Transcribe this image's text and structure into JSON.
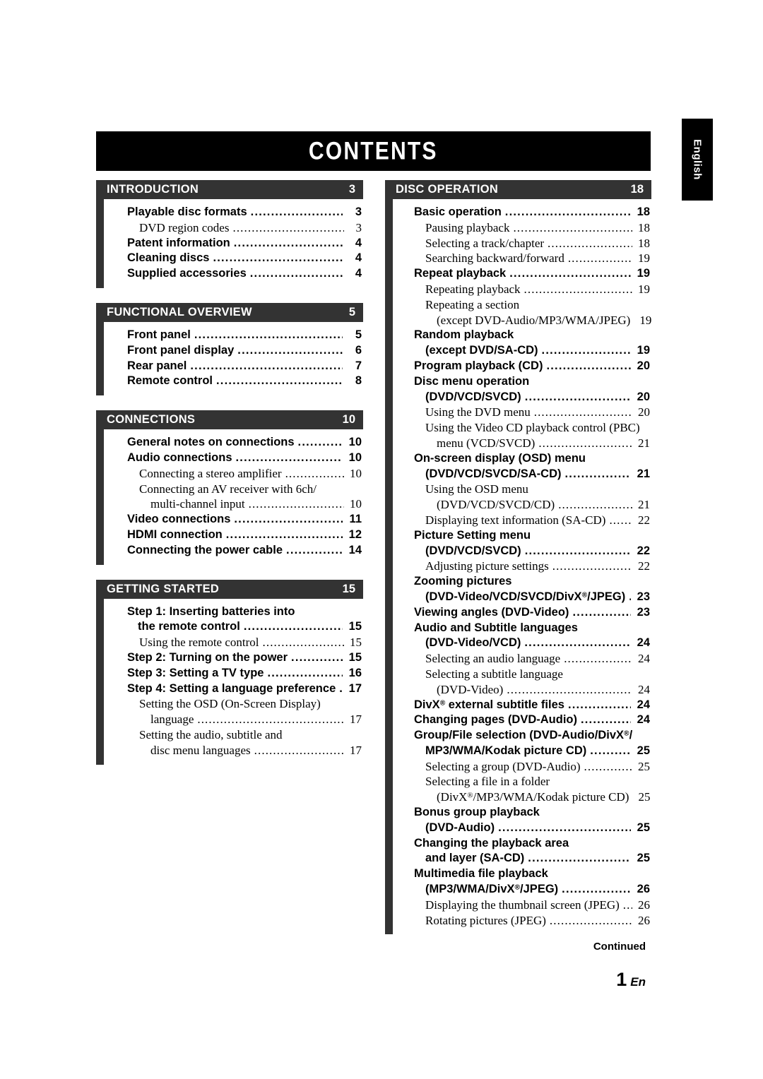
{
  "document": {
    "title": "CONTENTS",
    "language_tab": "English",
    "continued_label": "Continued",
    "page_number": "1",
    "page_suffix": "En",
    "colors": {
      "title_bar": "#000000",
      "section_header": "#333333",
      "text": "#000000",
      "header_text": "#ffffff"
    }
  },
  "columns": [
    {
      "id": "left",
      "sections": [
        {
          "title": "INTRODUCTION",
          "page": "3",
          "entries": [
            {
              "level": 1,
              "lines": [
                {
                  "text": "Playable disc formats",
                  "dots": true
                }
              ],
              "page": "3"
            },
            {
              "level": 2,
              "lines": [
                {
                  "text": "DVD region codes",
                  "dots": true
                }
              ],
              "page": "3"
            },
            {
              "level": 1,
              "lines": [
                {
                  "text": "Patent information",
                  "dots": true
                }
              ],
              "page": "4"
            },
            {
              "level": 1,
              "lines": [
                {
                  "text": "Cleaning discs",
                  "dots": true
                }
              ],
              "page": "4"
            },
            {
              "level": 1,
              "lines": [
                {
                  "text": "Supplied accessories",
                  "dots": true
                }
              ],
              "page": "4"
            }
          ]
        },
        {
          "title": "FUNCTIONAL OVERVIEW",
          "page": "5",
          "entries": [
            {
              "level": 1,
              "lines": [
                {
                  "text": "Front panel",
                  "dots": true
                }
              ],
              "page": "5"
            },
            {
              "level": 1,
              "lines": [
                {
                  "text": "Front panel display",
                  "dots": true
                }
              ],
              "page": "6"
            },
            {
              "level": 1,
              "lines": [
                {
                  "text": "Rear panel",
                  "dots": true
                }
              ],
              "page": "7"
            },
            {
              "level": 1,
              "lines": [
                {
                  "text": "Remote control",
                  "dots": true
                }
              ],
              "page": "8"
            }
          ]
        },
        {
          "title": "CONNECTIONS",
          "page": "10",
          "entries": [
            {
              "level": 1,
              "lines": [
                {
                  "text": "General notes on connections",
                  "dots": true
                }
              ],
              "page": "10"
            },
            {
              "level": 1,
              "lines": [
                {
                  "text": "Audio connections",
                  "dots": true
                }
              ],
              "page": "10"
            },
            {
              "level": 2,
              "lines": [
                {
                  "text": "Connecting a stereo amplifier",
                  "dots": true
                }
              ],
              "page": "10"
            },
            {
              "level": 2,
              "lines": [
                {
                  "text": "Connecting an AV receiver with 6ch/",
                  "dots": false
                },
                {
                  "text": "multi-channel input",
                  "dots": true,
                  "cont": true
                }
              ],
              "page": "10"
            },
            {
              "level": 1,
              "lines": [
                {
                  "text": "Video connections",
                  "dots": true
                }
              ],
              "page": "11"
            },
            {
              "level": 1,
              "lines": [
                {
                  "text": "HDMI connection",
                  "dots": true
                }
              ],
              "page": "12"
            },
            {
              "level": 1,
              "lines": [
                {
                  "text": "Connecting the power cable",
                  "dots": true
                }
              ],
              "page": "14"
            }
          ]
        },
        {
          "title": "GETTING STARTED",
          "page": "15",
          "entries": [
            {
              "level": 1,
              "lines": [
                {
                  "text": "Step 1: Inserting batteries into",
                  "dots": false
                },
                {
                  "text": "the remote control",
                  "dots": true,
                  "cont": true
                }
              ],
              "page": "15"
            },
            {
              "level": 2,
              "lines": [
                {
                  "text": "Using the remote control",
                  "dots": true
                }
              ],
              "page": "15"
            },
            {
              "level": 1,
              "lines": [
                {
                  "text": "Step 2: Turning on the power",
                  "dots": true
                }
              ],
              "page": "15"
            },
            {
              "level": 1,
              "lines": [
                {
                  "text": "Step 3: Setting a TV type",
                  "dots": true
                }
              ],
              "page": "16"
            },
            {
              "level": 1,
              "lines": [
                {
                  "text": "Step 4: Setting a language preference",
                  "dots": true
                }
              ],
              "page": "17"
            },
            {
              "level": 2,
              "lines": [
                {
                  "text": "Setting the OSD (On-Screen Display)",
                  "dots": false
                },
                {
                  "text": "language",
                  "dots": true,
                  "cont": true
                }
              ],
              "page": "17"
            },
            {
              "level": 2,
              "lines": [
                {
                  "text": "Setting the audio, subtitle and",
                  "dots": false
                },
                {
                  "text": "disc menu languages",
                  "dots": true,
                  "cont": true
                }
              ],
              "page": "17"
            }
          ]
        }
      ]
    },
    {
      "id": "right",
      "sections": [
        {
          "title": "DISC OPERATION",
          "page": "18",
          "entries": [
            {
              "level": 1,
              "lines": [
                {
                  "text": "Basic operation",
                  "dots": true
                }
              ],
              "page": "18"
            },
            {
              "level": 2,
              "lines": [
                {
                  "text": "Pausing playback",
                  "dots": true
                }
              ],
              "page": "18"
            },
            {
              "level": 2,
              "lines": [
                {
                  "text": "Selecting a track/chapter",
                  "dots": true
                }
              ],
              "page": "18"
            },
            {
              "level": 2,
              "lines": [
                {
                  "text": "Searching backward/forward",
                  "dots": true
                }
              ],
              "page": "19"
            },
            {
              "level": 1,
              "lines": [
                {
                  "text": "Repeat playback",
                  "dots": true
                }
              ],
              "page": "19"
            },
            {
              "level": 2,
              "lines": [
                {
                  "text": "Repeating playback",
                  "dots": true
                }
              ],
              "page": "19"
            },
            {
              "level": 2,
              "lines": [
                {
                  "text": "Repeating a section",
                  "dots": false
                },
                {
                  "text": "(except DVD-Audio/MP3/WMA/JPEG)",
                  "dots": true,
                  "cont": true
                }
              ],
              "page": "19"
            },
            {
              "level": 1,
              "lines": [
                {
                  "text": "Random playback",
                  "dots": false
                },
                {
                  "text": "(except DVD/SA-CD)",
                  "dots": true,
                  "cont": true
                }
              ],
              "page": "19"
            },
            {
              "level": 1,
              "lines": [
                {
                  "text": "Program playback (CD)",
                  "dots": true
                }
              ],
              "page": "20"
            },
            {
              "level": 1,
              "lines": [
                {
                  "text": "Disc menu operation",
                  "dots": false
                },
                {
                  "text": "(DVD/VCD/SVCD)",
                  "dots": true,
                  "cont": true
                }
              ],
              "page": "20"
            },
            {
              "level": 2,
              "lines": [
                {
                  "text": "Using the DVD menu",
                  "dots": true
                }
              ],
              "page": "20"
            },
            {
              "level": 2,
              "lines": [
                {
                  "text": "Using the Video CD playback control (PBC)",
                  "dots": false
                },
                {
                  "text": "menu (VCD/SVCD)",
                  "dots": true,
                  "cont": true
                }
              ],
              "page": "21"
            },
            {
              "level": 1,
              "lines": [
                {
                  "text": "On-screen display (OSD) menu",
                  "dots": false
                },
                {
                  "text": "(DVD/VCD/SVCD/SA-CD)",
                  "dots": true,
                  "cont": true
                }
              ],
              "page": "21"
            },
            {
              "level": 2,
              "lines": [
                {
                  "text": "Using the OSD menu",
                  "dots": false
                },
                {
                  "text": "(DVD/VCD/SVCD/CD)",
                  "dots": true,
                  "cont": true
                }
              ],
              "page": "21"
            },
            {
              "level": 2,
              "lines": [
                {
                  "text": "Displaying text information (SA-CD)",
                  "dots": true
                }
              ],
              "page": "22"
            },
            {
              "level": 1,
              "lines": [
                {
                  "text": "Picture Setting menu",
                  "dots": false
                },
                {
                  "text": "(DVD/VCD/SVCD)",
                  "dots": true,
                  "cont": true
                }
              ],
              "page": "22"
            },
            {
              "level": 2,
              "lines": [
                {
                  "text": "Adjusting picture settings",
                  "dots": true
                }
              ],
              "page": "22"
            },
            {
              "level": 1,
              "lines": [
                {
                  "text": "Zooming pictures",
                  "dots": false
                },
                {
                  "html": "(DVD-Video/VCD/SVCD/DivX<sup class=\"reg\">&#174;</sup>/JPEG)",
                  "dots": true,
                  "cont": true
                }
              ],
              "page": "23"
            },
            {
              "level": 1,
              "lines": [
                {
                  "text": "Viewing angles (DVD-Video)",
                  "dots": true
                }
              ],
              "page": "23"
            },
            {
              "level": 1,
              "lines": [
                {
                  "text": "Audio and Subtitle languages",
                  "dots": false
                },
                {
                  "text": "(DVD-Video/VCD)",
                  "dots": true,
                  "cont": true
                }
              ],
              "page": "24"
            },
            {
              "level": 2,
              "lines": [
                {
                  "text": "Selecting an audio language",
                  "dots": true
                }
              ],
              "page": "24"
            },
            {
              "level": 2,
              "lines": [
                {
                  "text": "Selecting a subtitle language",
                  "dots": false
                },
                {
                  "text": "(DVD-Video)",
                  "dots": true,
                  "cont": true
                }
              ],
              "page": "24"
            },
            {
              "level": 1,
              "lines": [
                {
                  "html": "DivX<sup class=\"reg\">&#174;</sup> external subtitle files",
                  "dots": true
                }
              ],
              "page": "24"
            },
            {
              "level": 1,
              "lines": [
                {
                  "text": "Changing pages (DVD-Audio)",
                  "dots": true
                }
              ],
              "page": "24"
            },
            {
              "level": 1,
              "lines": [
                {
                  "html": "Group/File selection (DVD-Audio/DivX<sup class=\"reg\">&#174;</sup>/",
                  "dots": false
                },
                {
                  "text": "MP3/WMA/Kodak picture CD)",
                  "dots": true,
                  "cont": true
                }
              ],
              "page": "25"
            },
            {
              "level": 2,
              "lines": [
                {
                  "text": "Selecting a group (DVD-Audio)",
                  "dots": true
                }
              ],
              "page": "25"
            },
            {
              "level": 2,
              "lines": [
                {
                  "text": "Selecting a file in a folder",
                  "dots": false
                },
                {
                  "html": "(DivX<sup class=\"reg\">&#174;</sup>/MP3/WMA/Kodak picture CD)",
                  "dots": true,
                  "cont": true
                }
              ],
              "page": "25"
            },
            {
              "level": 1,
              "lines": [
                {
                  "text": "Bonus group playback",
                  "dots": false
                },
                {
                  "text": "(DVD-Audio)",
                  "dots": true,
                  "cont": true
                }
              ],
              "page": "25"
            },
            {
              "level": 1,
              "lines": [
                {
                  "text": "Changing the playback area",
                  "dots": false
                },
                {
                  "text": "and layer (SA-CD)",
                  "dots": true,
                  "cont": true
                }
              ],
              "page": "25"
            },
            {
              "level": 1,
              "lines": [
                {
                  "text": "Multimedia file playback",
                  "dots": false
                },
                {
                  "html": "(MP3/WMA/DivX<sup class=\"reg\">&#174;</sup>/JPEG)",
                  "dots": true,
                  "cont": true
                }
              ],
              "page": "26"
            },
            {
              "level": 2,
              "lines": [
                {
                  "text": "Displaying the thumbnail screen (JPEG)",
                  "dots": true
                }
              ],
              "page": "26"
            },
            {
              "level": 2,
              "lines": [
                {
                  "text": "Rotating pictures (JPEG)",
                  "dots": true
                }
              ],
              "page": "26"
            }
          ]
        }
      ]
    }
  ]
}
